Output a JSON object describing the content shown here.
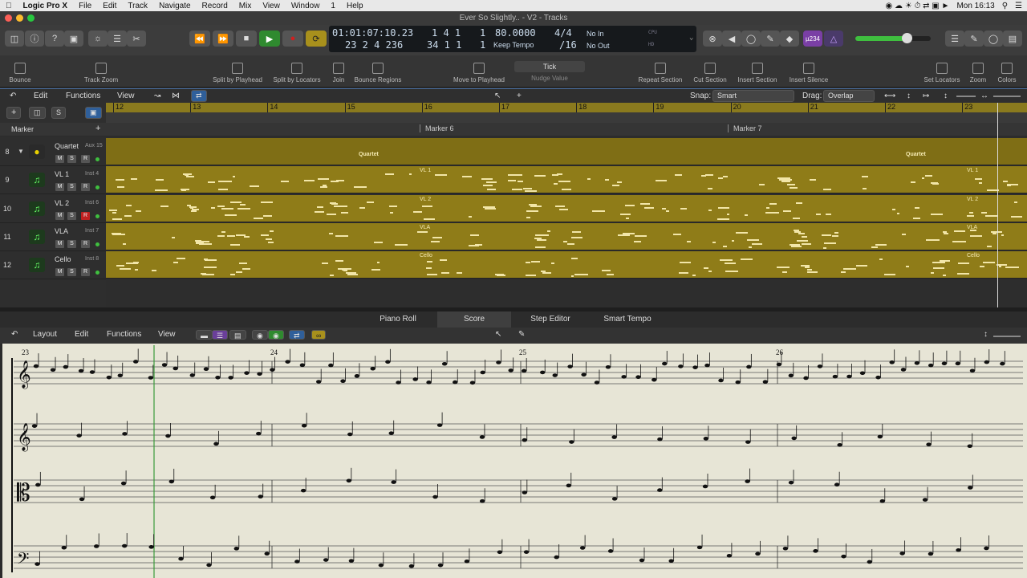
{
  "menubar": {
    "app": "Logic Pro X",
    "items": [
      "File",
      "Edit",
      "Track",
      "Navigate",
      "Record",
      "Mix",
      "View",
      "Window",
      "1",
      "Help"
    ],
    "clock": "Mon 16:13"
  },
  "window": {
    "title": "Ever So Slightly.. - V2 - Tracks"
  },
  "lcd": {
    "position_time": "01:01:07:10.23",
    "position_bars": "23  2  4  236",
    "cycle_left": "1 4 1",
    "cycle_left2": "1",
    "cycle_right": "34 1 1",
    "cycle_right2": "1",
    "tempo": "80.0000",
    "tempo_mode": "Keep Tempo",
    "signature": "4/4",
    "division": "/16",
    "in_label": "No In",
    "out_label": "No Out",
    "cpu_label": "CPU",
    "hd_label": "HD"
  },
  "control": {
    "key_badge": "µ234"
  },
  "toolbar": {
    "items": [
      "Bounce",
      "Track Zoom",
      "Split by Playhead",
      "Split by Locators",
      "Join",
      "Bounce Regions",
      "Move to Playhead",
      "Nudge Value",
      "Repeat Section",
      "Cut Section",
      "Insert Section",
      "Insert Silence",
      "Set Locators",
      "Zoom",
      "Colors"
    ],
    "nudge_value": "Tick"
  },
  "tracks_header": {
    "edit": "Edit",
    "functions": "Functions",
    "view": "View",
    "snap_label": "Snap:",
    "snap_value": "Smart",
    "drag_label": "Drag:",
    "drag_value": "Overlap",
    "s_button": "S"
  },
  "ruler": {
    "bars": [
      "12",
      "13",
      "14",
      "15",
      "16",
      "17",
      "18",
      "19",
      "20",
      "21",
      "22",
      "23"
    ]
  },
  "markers": {
    "label": "Marker",
    "items": [
      "Marker 6",
      "Marker 7"
    ]
  },
  "tracks": [
    {
      "num": "8",
      "name": "Quartet",
      "inst": "Aux 15",
      "m": "M",
      "s": "S",
      "r": "R",
      "regions": [
        "Quartet",
        "Quartet"
      ]
    },
    {
      "num": "9",
      "name": "VL 1",
      "inst": "Inst 4",
      "m": "M",
      "s": "S",
      "r": "R",
      "regions": [
        "VL 1",
        "VL 1"
      ]
    },
    {
      "num": "10",
      "name": "VL 2",
      "inst": "Inst 6",
      "m": "M",
      "s": "S",
      "r": "R",
      "regions": [
        "VL 2",
        "VL 2"
      ]
    },
    {
      "num": "11",
      "name": "VLA",
      "inst": "Inst 7",
      "m": "M",
      "s": "S",
      "r": "R",
      "regions": [
        "VLA",
        "VLA"
      ]
    },
    {
      "num": "12",
      "name": "Cello",
      "inst": "Inst 8",
      "m": "M",
      "s": "S",
      "r": "R",
      "regions": [
        "Cello",
        "Cello"
      ]
    }
  ],
  "editor": {
    "tabs": [
      "Piano Roll",
      "Score",
      "Step Editor",
      "Smart Tempo"
    ],
    "menus": [
      "Layout",
      "Edit",
      "Functions",
      "View"
    ]
  },
  "score": {
    "measures": [
      "23",
      "24",
      "25",
      "26"
    ]
  },
  "colors": {
    "region": "#8f7c18",
    "ruler": "#8a7a1e",
    "play_green": "#2f8a2f",
    "record_red": "#d02020"
  }
}
